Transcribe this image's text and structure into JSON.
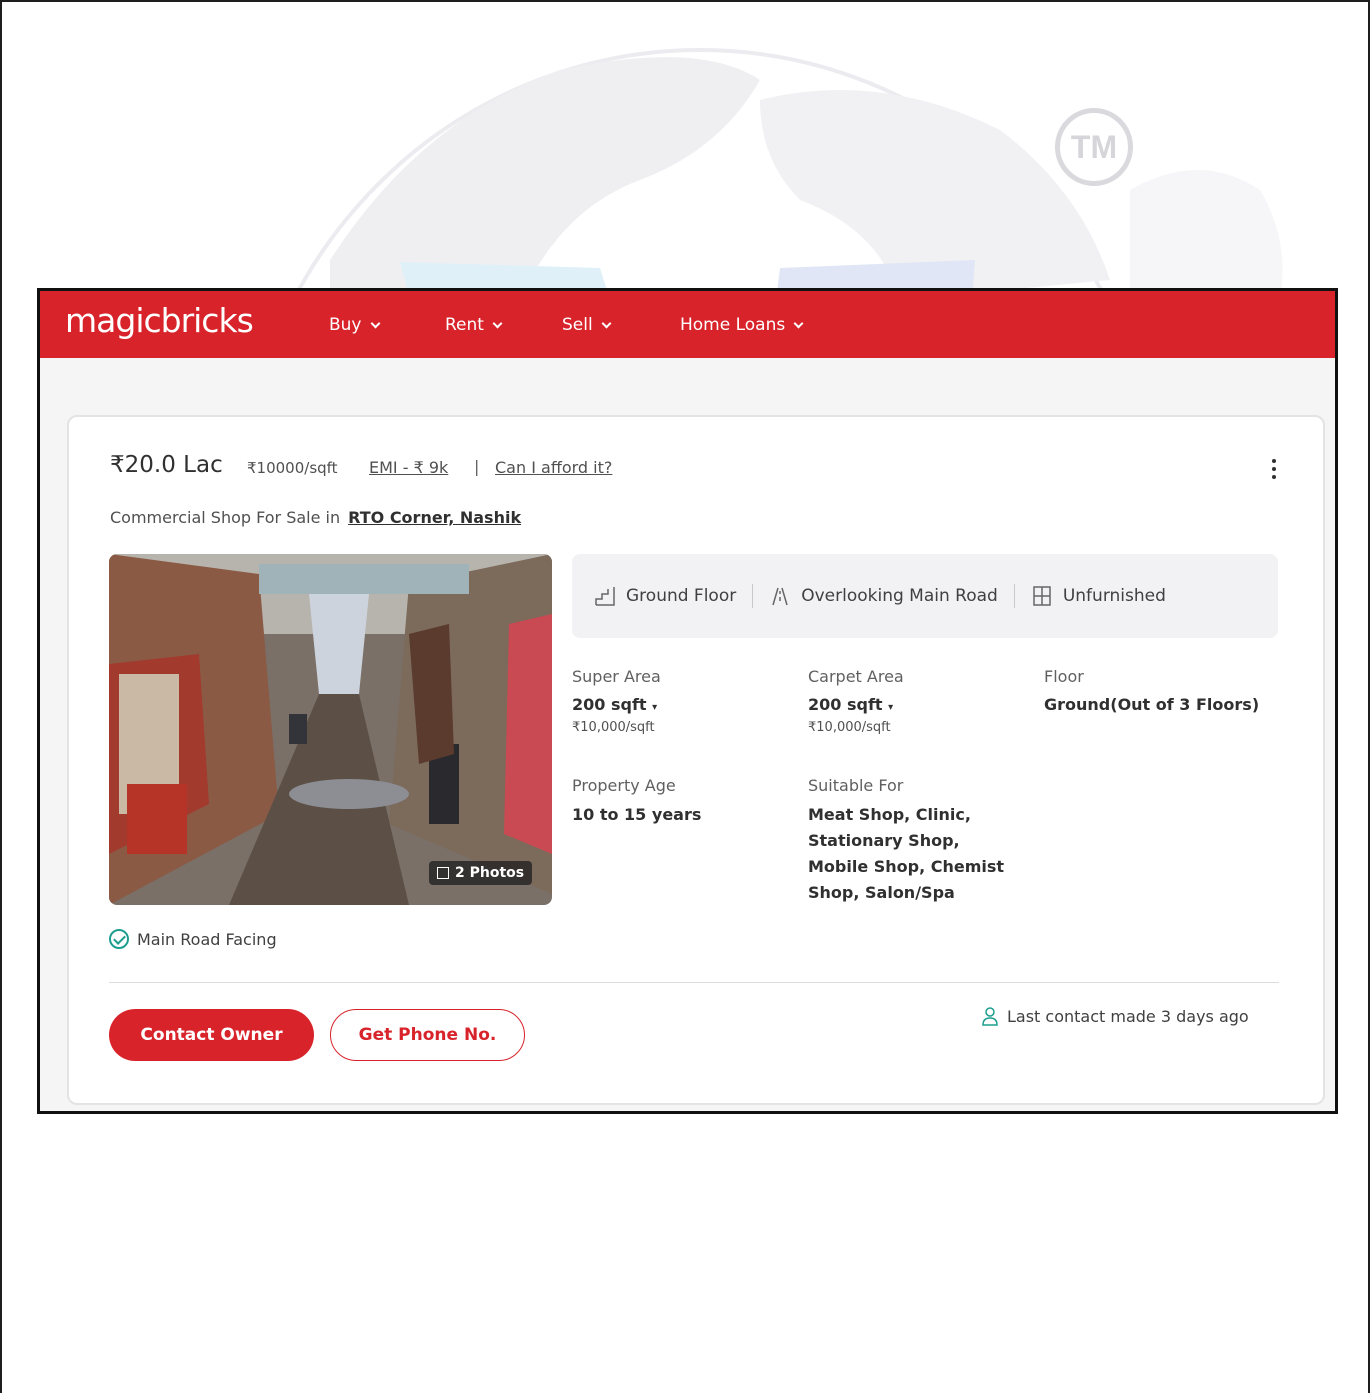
{
  "watermark": {
    "tm": "TM"
  },
  "header": {
    "logo": "magicbricks",
    "nav": [
      "Buy",
      "Rent",
      "Sell",
      "Home Loans"
    ]
  },
  "listing": {
    "price": "₹20.0 Lac",
    "price_per_sqft": "₹10000/sqft",
    "emi": "EMI - ₹ 9k",
    "separator": "|",
    "afford_link": "Can I afford it?",
    "title_prefix": "Commercial Shop For Sale in",
    "location": "RTO Corner, Nashik",
    "photos_badge": "2 Photos",
    "highlights": [
      "Ground Floor",
      "Overlooking Main Road",
      "Unfurnished"
    ],
    "specs": {
      "super_area_label": "Super Area",
      "super_area_value": "200 sqft",
      "super_area_rate": "₹10,000/sqft",
      "carpet_area_label": "Carpet Area",
      "carpet_area_value": "200 sqft",
      "carpet_area_rate": "₹10,000/sqft",
      "floor_label": "Floor",
      "floor_value": "Ground(Out of 3 Floors)",
      "property_age_label": "Property Age",
      "property_age_value": "10 to 15 years",
      "suitable_for_label": "Suitable For",
      "suitable_for_lines": [
        "Meat Shop, Clinic,",
        "Stationary Shop,",
        "Mobile Shop, Chemist",
        "Shop, Salon/Spa"
      ]
    },
    "feature": "Main Road Facing",
    "contact_button": "Contact Owner",
    "phone_button": "Get Phone No.",
    "last_contact": "Last contact made 3 days ago"
  },
  "colors": {
    "brand": "#d8232a",
    "accent_green": "#1d9e8e"
  }
}
